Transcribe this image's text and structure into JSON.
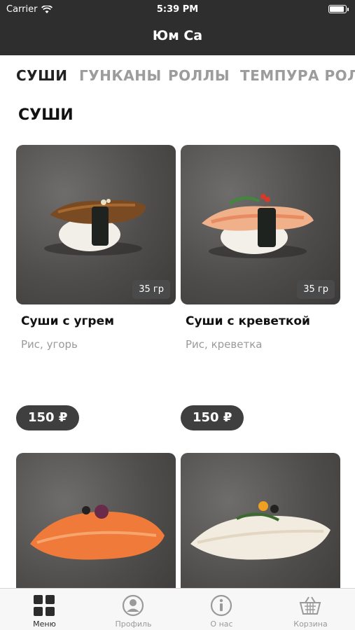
{
  "status_bar": {
    "carrier": "Carrier",
    "time": "5:39 PM"
  },
  "header": {
    "title": "Юм Са"
  },
  "categories": [
    {
      "label": "СУШИ",
      "active": true
    },
    {
      "label": "ГУНКАНЫ",
      "active": false
    },
    {
      "label": "РОЛЛЫ",
      "active": false
    },
    {
      "label": "ТЕМПУРА РОЛЛЫ",
      "active": false
    }
  ],
  "section": {
    "title": "СУШИ"
  },
  "products": [
    {
      "name": "Суши с угрем",
      "description": "Рис, угорь",
      "weight": "35 гр",
      "price": "150 ₽"
    },
    {
      "name": "Суши с креветкой",
      "description": "Рис, креветка",
      "weight": "35 гр",
      "price": "150 ₽"
    },
    {
      "name": "",
      "description": "",
      "weight": "",
      "price": ""
    },
    {
      "name": "",
      "description": "",
      "weight": "",
      "price": ""
    }
  ],
  "tabbar": [
    {
      "label": "Меню",
      "icon": "menu-grid-icon",
      "active": true
    },
    {
      "label": "Профиль",
      "icon": "profile-icon",
      "active": false
    },
    {
      "label": "О нас",
      "icon": "info-icon",
      "active": false
    },
    {
      "label": "Корзина",
      "icon": "basket-icon",
      "active": false
    }
  ],
  "colors": {
    "header": "#2e2e2e",
    "price_pill": "#3f3f3f",
    "active_text": "#222222",
    "inactive_text": "#9c9c9c"
  }
}
